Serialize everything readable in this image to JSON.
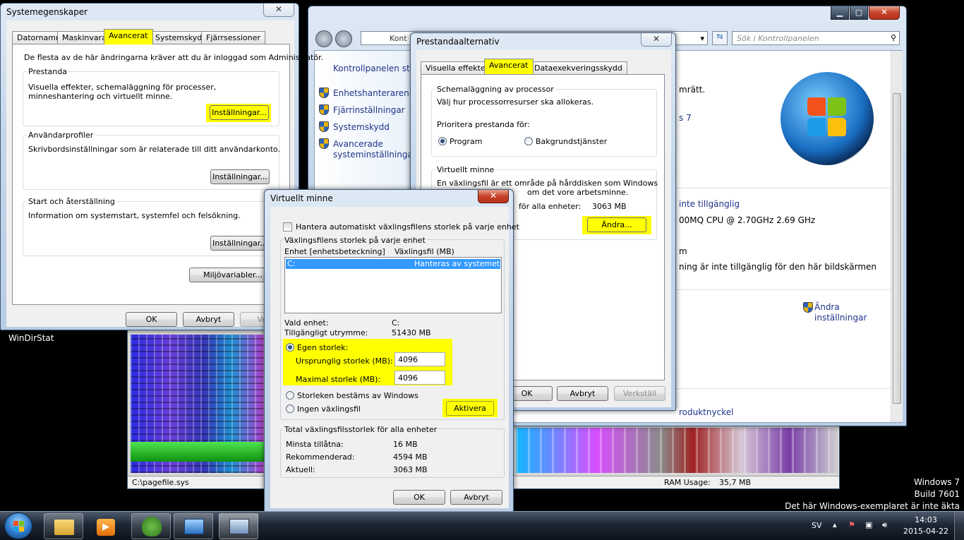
{
  "sysprops": {
    "title": "Systemegenskaper",
    "close": "✕",
    "tabs": [
      "Datornamn",
      "Maskinvara",
      "Avancerat",
      "Systemskydd",
      "Fjärrsessioner"
    ],
    "admin_note": "De flesta av de här ändringarna kräver att du är inloggad som Administratör.",
    "perf_label": "Prestanda",
    "perf_desc": "Visuella effekter, schemaläggning för processer, minneshantering och virtuellt minne.",
    "settings": "Inställningar...",
    "profiles_label": "Användarprofiler",
    "profiles_desc": "Skrivbordsinställningar som är relaterade till ditt användarkonto.",
    "startup_label": "Start och återställning",
    "startup_desc": "Information om systemstart, systemfel och felsökning.",
    "env_vars": "Miljövariabler...",
    "ok": "OK",
    "cancel": "Avbryt",
    "apply_partial": "Verk"
  },
  "controlpanel": {
    "breadcrumb": "Kont",
    "search_placeholder": "Sök i Kontrollpanelen",
    "side_home": "Kontrollpanelen start",
    "side_links": [
      "Enhetshanteraren",
      "Fjärrinställningar",
      "Systemskydd",
      "Avancerade systeminställningar"
    ],
    "frag_right": "mrätt.",
    "frag_s7": "s 7",
    "frag_avail": "inte tillgänglig",
    "frag_cpu": "00MQ CPU @ 2.70GHz   2.69 GHz",
    "frag_m": "m",
    "frag_touch": "ning är inte tillgänglig för den här bildskärmen",
    "change_settings": "Ändra inställningar",
    "product_key": "roduktnyckel"
  },
  "perfopts": {
    "title": "Prestandaalternativ",
    "close": "✕",
    "tabs": [
      "Visuella effekter",
      "Avancerat",
      "Dataexekveringsskydd"
    ],
    "sched_label": "Schemaläggning av processor",
    "sched_desc": "Välj hur processorresurser ska allokeras.",
    "prio_label": "Prioritera prestanda för:",
    "opt_program": "Program",
    "opt_bg": "Bakgrundstjänster",
    "vm_label": "Virtuellt minne",
    "vm_desc1": "En växlingsfil är ett område på hårddisken som Windows",
    "vm_desc2": "om det vore arbetsminne.",
    "vm_total_label": "för alla enheter:",
    "vm_total_value": "3063 MB",
    "change": "Ändra...",
    "ok": "OK",
    "cancel": "Avbryt",
    "apply": "Verkställ"
  },
  "vmem": {
    "title": "Virtuellt minne",
    "close": "✕",
    "auto_label": "Hantera automatiskt växlingsfilens storlek på varje enhet",
    "per_drive_label": "Växlingsfilens storlek på varje enhet",
    "col_drive": "Enhet [enhetsbeteckning]",
    "col_pagefile": "Växlingsfil (MB)",
    "row_drive": "C:",
    "row_value": "Hanteras av systemet",
    "sel_drive_label": "Vald enhet:",
    "sel_drive_value": "C:",
    "free_label": "Tillgängligt utrymme:",
    "free_value": "51430 MB",
    "custom_label": "Egen storlek:",
    "initial_label": "Ursprunglig storlek (MB):",
    "initial_value": "4096",
    "max_label": "Maximal storlek (MB):",
    "max_value": "4096",
    "system_label": "Storleken bestäms av Windows",
    "none_label": "Ingen växlingsfil",
    "set": "Aktivera",
    "total_label": "Total växlingsfilsstorlek för alla enheter",
    "min_label": "Minsta tillåtna:",
    "min_value": "16 MB",
    "rec_label": "Rekommenderad:",
    "rec_value": "4594 MB",
    "cur_label": "Aktuell:",
    "cur_value": "3063 MB",
    "ok": "OK",
    "cancel": "Avbryt"
  },
  "windirstat": {
    "title": "WinDirStat",
    "status_path": "C:\\pagefile.sys",
    "ram_usage": "RAM Usage:",
    "ram_value": "35,7 MB"
  },
  "desktop": {
    "watermark1": "Windows 7",
    "watermark2": "Build 7601",
    "watermark3": "Det här Windows-exemplaret är inte äkta"
  },
  "taskbar": {
    "lang": "SV",
    "time": "14:03",
    "date": "2015-04-22"
  },
  "colors": {
    "highlight": "#ffff00",
    "selection": "#3399ff"
  }
}
